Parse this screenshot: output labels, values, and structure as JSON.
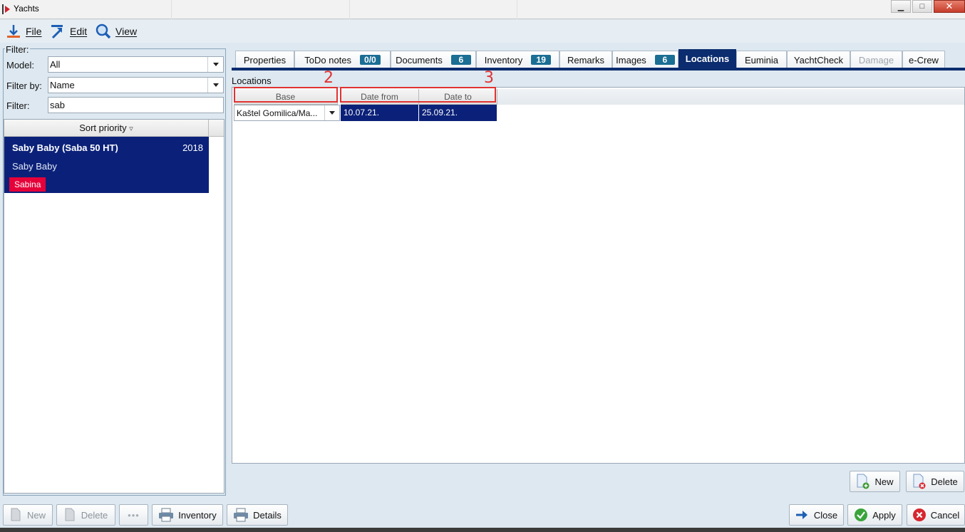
{
  "window": {
    "title": "Yachts",
    "buttons": {
      "minimize": "▁",
      "maximize": "□",
      "close": "✕"
    }
  },
  "menu": [
    {
      "label": "File",
      "icon": "file-icon"
    },
    {
      "label": "Edit",
      "icon": "edit-icon"
    },
    {
      "label": "View",
      "icon": "view-icon"
    }
  ],
  "filter": {
    "title": "Filter:",
    "model_label": "Model:",
    "model_value": "All",
    "filter_by_label": "Filter by:",
    "filter_by_value": "Name",
    "filter_label": "Filter:",
    "filter_value": "sab"
  },
  "yacht_list": {
    "header": "Sort priority",
    "sort_glyph": "▿",
    "items": [
      {
        "name": "Saby Baby (Saba 50 HT)",
        "year": "2018",
        "subtitle": "Saby Baby",
        "tag": "Sabina"
      }
    ]
  },
  "tabs": [
    {
      "label": "Properties"
    },
    {
      "label": "ToDo notes",
      "badge": "0/0"
    },
    {
      "label": "Documents",
      "badge": "6"
    },
    {
      "label": "Inventory",
      "badge": "19"
    },
    {
      "label": "Remarks"
    },
    {
      "label": "Images",
      "badge": "6"
    },
    {
      "label": "Locations",
      "active": true
    },
    {
      "label": "Euminia"
    },
    {
      "label": "YachtCheck"
    },
    {
      "label": "Damage",
      "disabled": true
    },
    {
      "label": "e-Crew"
    }
  ],
  "locations": {
    "section_label": "Locations",
    "columns": [
      "Base",
      "Date from",
      "Date to"
    ],
    "rows": [
      {
        "base": "Kaštel Gomilica/Ma...",
        "date_from": "10.07.21.",
        "date_to": "25.09.21."
      }
    ]
  },
  "annotations": [
    "2",
    "3"
  ],
  "buttons": {
    "loc_new": "New",
    "loc_delete": "Delete",
    "new": "New",
    "delete": "Delete",
    "more": "•••",
    "inventory": "Inventory",
    "details": "Details",
    "close": "Close",
    "apply": "Apply",
    "cancel": "Cancel"
  },
  "colors": {
    "selection": "#0b2179",
    "active_tab": "#0b2c6e",
    "badge": "#1b6e94",
    "tag": "#e6003a",
    "annotation": "#e23232"
  }
}
